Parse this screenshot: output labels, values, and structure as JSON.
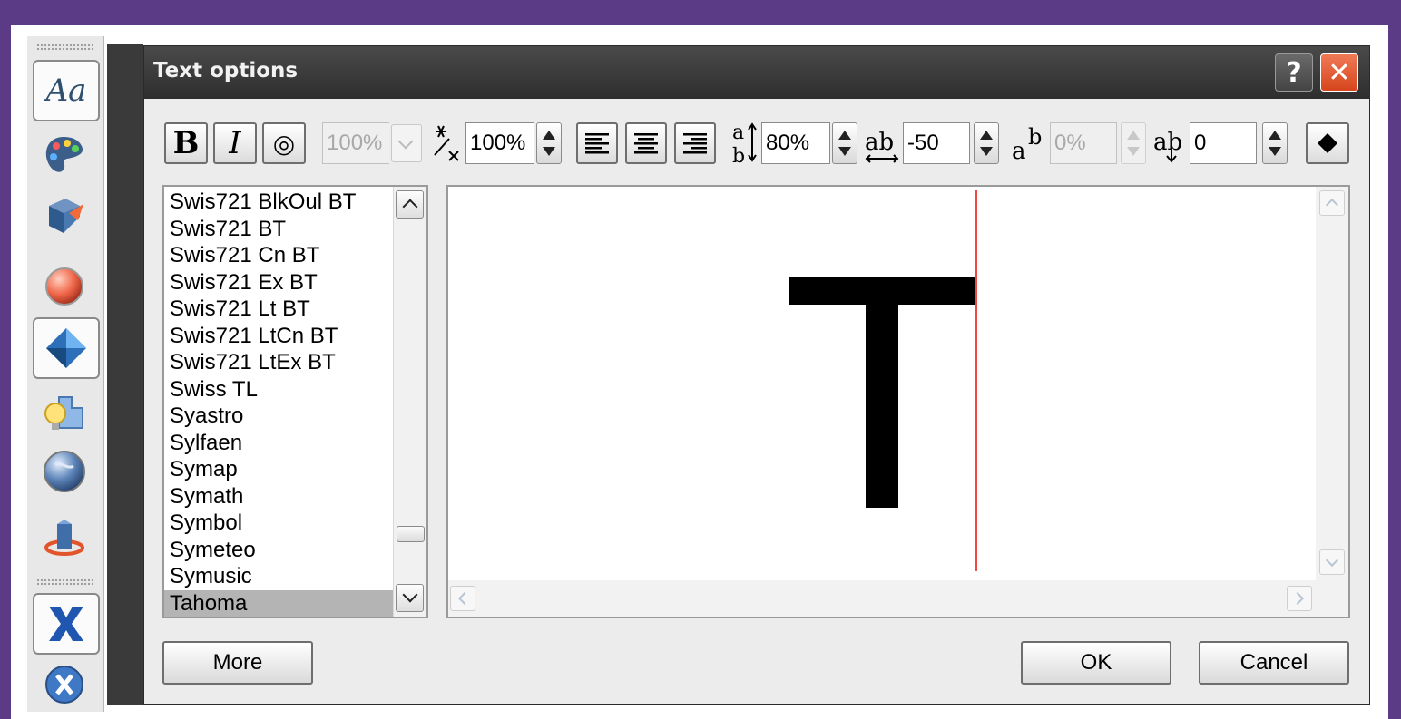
{
  "dialog": {
    "title": "Text options",
    "help_label": "?",
    "close_label": "✕"
  },
  "toolbar": {
    "bold_label": "B",
    "italic_label": "I",
    "outline_label": "◎",
    "scale_value": "100%",
    "char_width_value": "100%",
    "line_spacing_value": "80%",
    "kerning_value": "-50",
    "superscript_value": "0%",
    "baseline_value": "0",
    "align_left": "left",
    "align_center": "center",
    "align_right": "right"
  },
  "fonts": {
    "items": [
      "Swis721 BlkOul BT",
      "Swis721 BT",
      "Swis721 Cn BT",
      "Swis721 Ex BT",
      "Swis721 Lt BT",
      "Swis721 LtCn BT",
      "Swis721 LtEx BT",
      "Swiss TL",
      "Syastro",
      "Sylfaen",
      "Symap",
      "Symath",
      "Symbol",
      "Symeteo",
      "Symusic",
      "Tahoma"
    ],
    "selected": "Tahoma"
  },
  "preview": {
    "text": "T"
  },
  "buttons": {
    "more": "More",
    "ok": "OK",
    "cancel": "Cancel"
  },
  "sidebar": {
    "text_tool_label": "Aa"
  },
  "colors": {
    "background": "#5b3a86",
    "titlebar": "#3a3a3a",
    "close": "#e35a30",
    "selection": "#b4b4b4",
    "cursor_line": "#ef4848"
  }
}
